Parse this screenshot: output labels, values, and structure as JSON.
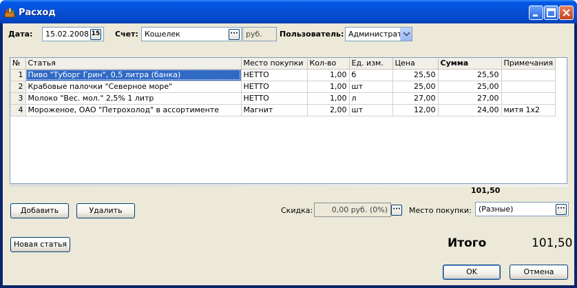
{
  "window": {
    "title": "Расход"
  },
  "form": {
    "date_label": "Дата:",
    "date_value": "15.02.2008",
    "date_btn": "15",
    "account_label": "Счет:",
    "account_value": "Кошелек",
    "currency": "руб.",
    "user_label": "Пользователь:",
    "user_value": "Администратор"
  },
  "table": {
    "columns": [
      "№",
      "Статья",
      "Место покупки",
      "Кол-во",
      "Ед. изм.",
      "Цена",
      "Сумма",
      "Примечания"
    ],
    "rows": [
      {
        "n": "1",
        "item": "Пиво \"Туборг Грин\", 0,5 литра (банка)",
        "place": "НЕТТО",
        "qty": "1,00",
        "unit": "б",
        "price": "25,50",
        "sum": "25,50",
        "note": ""
      },
      {
        "n": "2",
        "item": "Крабовые палочки \"Северное море\"",
        "place": "НЕТТО",
        "qty": "1,00",
        "unit": "шт",
        "price": "25,00",
        "sum": "25,00",
        "note": ""
      },
      {
        "n": "3",
        "item": "Молоко \"Вес. мол.\" 2,5% 1 литр",
        "place": "НЕТТО",
        "qty": "1,00",
        "unit": "л",
        "price": "27,00",
        "sum": "27,00",
        "note": ""
      },
      {
        "n": "4",
        "item": "Мороженое, ОАО \"Петрохолод\" в ассортименте",
        "place": "Магнит",
        "qty": "2,00",
        "unit": "шт",
        "price": "12,00",
        "sum": "24,00",
        "note": "митя 1х2"
      }
    ],
    "footer_total": "101,50"
  },
  "actions": {
    "add": "Добавить",
    "delete": "Удалить",
    "discount_label": "Скидка:",
    "discount_value": "0,00 руб. (0%)",
    "place_label": "Место покупки:",
    "place_value": "(Разные)",
    "new_item": "Новая статья",
    "total_label": "Итого",
    "total_value": "101,50",
    "ok": "OK",
    "cancel": "Отмена"
  },
  "colors": {
    "selection": "#316ac5",
    "titlebar": "#0054e3",
    "dialog_bg": "#ece9d8"
  }
}
